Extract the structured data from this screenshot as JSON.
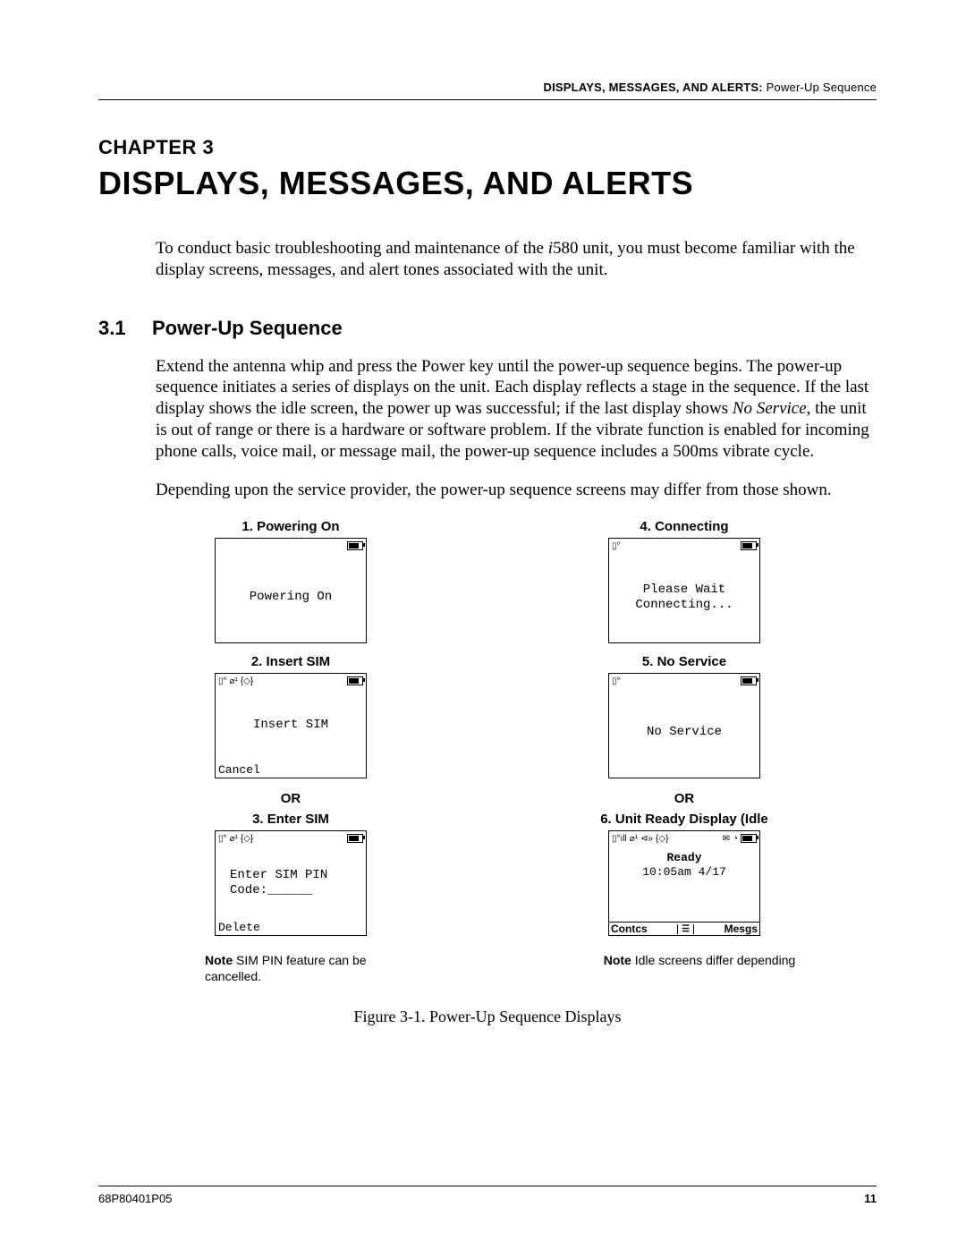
{
  "header": {
    "bold": "DISPLAYS, MESSAGES, AND ALERTS:",
    "rest": "  Power-Up Sequence"
  },
  "chapter": {
    "label": "CHAPTER 3",
    "title": "DISPLAYS, MESSAGES, AND ALERTS"
  },
  "intro_before_i": "To conduct basic troubleshooting and maintenance of the ",
  "intro_i": "i",
  "intro_after_i": "580 unit, you must become familiar with the display screens, messages, and alert tones associated with the unit.",
  "section": {
    "number": "3.1",
    "title": "Power-Up Sequence"
  },
  "para1_a": "Extend the antenna whip and press the Power key until the power-up sequence begins. The power-up sequence initiates a series of displays on the unit. Each display reflects a stage in the sequence. If the last display shows the idle screen, the power up was successful; if the last display shows ",
  "para1_i": "No Service",
  "para1_b": ", the unit is out of range or there is a hardware or software problem. If the vibrate function is enabled for incoming phone calls, voice mail, or message mail, the power-up sequence includes a 500ms vibrate cycle.",
  "para2": "Depending upon the service provider, the power-up sequence screens may differ from those shown.",
  "screens": {
    "s1": {
      "title": "1. Powering On",
      "line1": "Powering On"
    },
    "s2": {
      "title": "2. Insert SIM",
      "line1": "Insert SIM",
      "soft_left": "Cancel"
    },
    "or": "OR",
    "s3": {
      "title": "3. Enter SIM",
      "line1": "Enter SIM PIN",
      "line2": "Code:______",
      "soft_left": "Delete"
    },
    "note_left_label": "Note",
    "note_left_text": " SIM PIN feature can be cancelled.",
    "s4": {
      "title": "4. Connecting",
      "line1": "Please Wait",
      "line2": "Connecting..."
    },
    "s5": {
      "title": "5. No Service",
      "line1": "No Service"
    },
    "s6": {
      "title": "6. Unit Ready Display (Idle",
      "ready": "Ready",
      "time": "10:05am 4/17",
      "soft_left": "Contcs",
      "soft_mid": "☰",
      "soft_right": "Mesgs"
    },
    "note_right_label": "Note",
    "note_right_text": " Idle screens differ depending"
  },
  "figure_caption": "Figure 3-1.  Power-Up Sequence Displays",
  "footer": {
    "doc": "68P80401P05",
    "page": "11"
  }
}
